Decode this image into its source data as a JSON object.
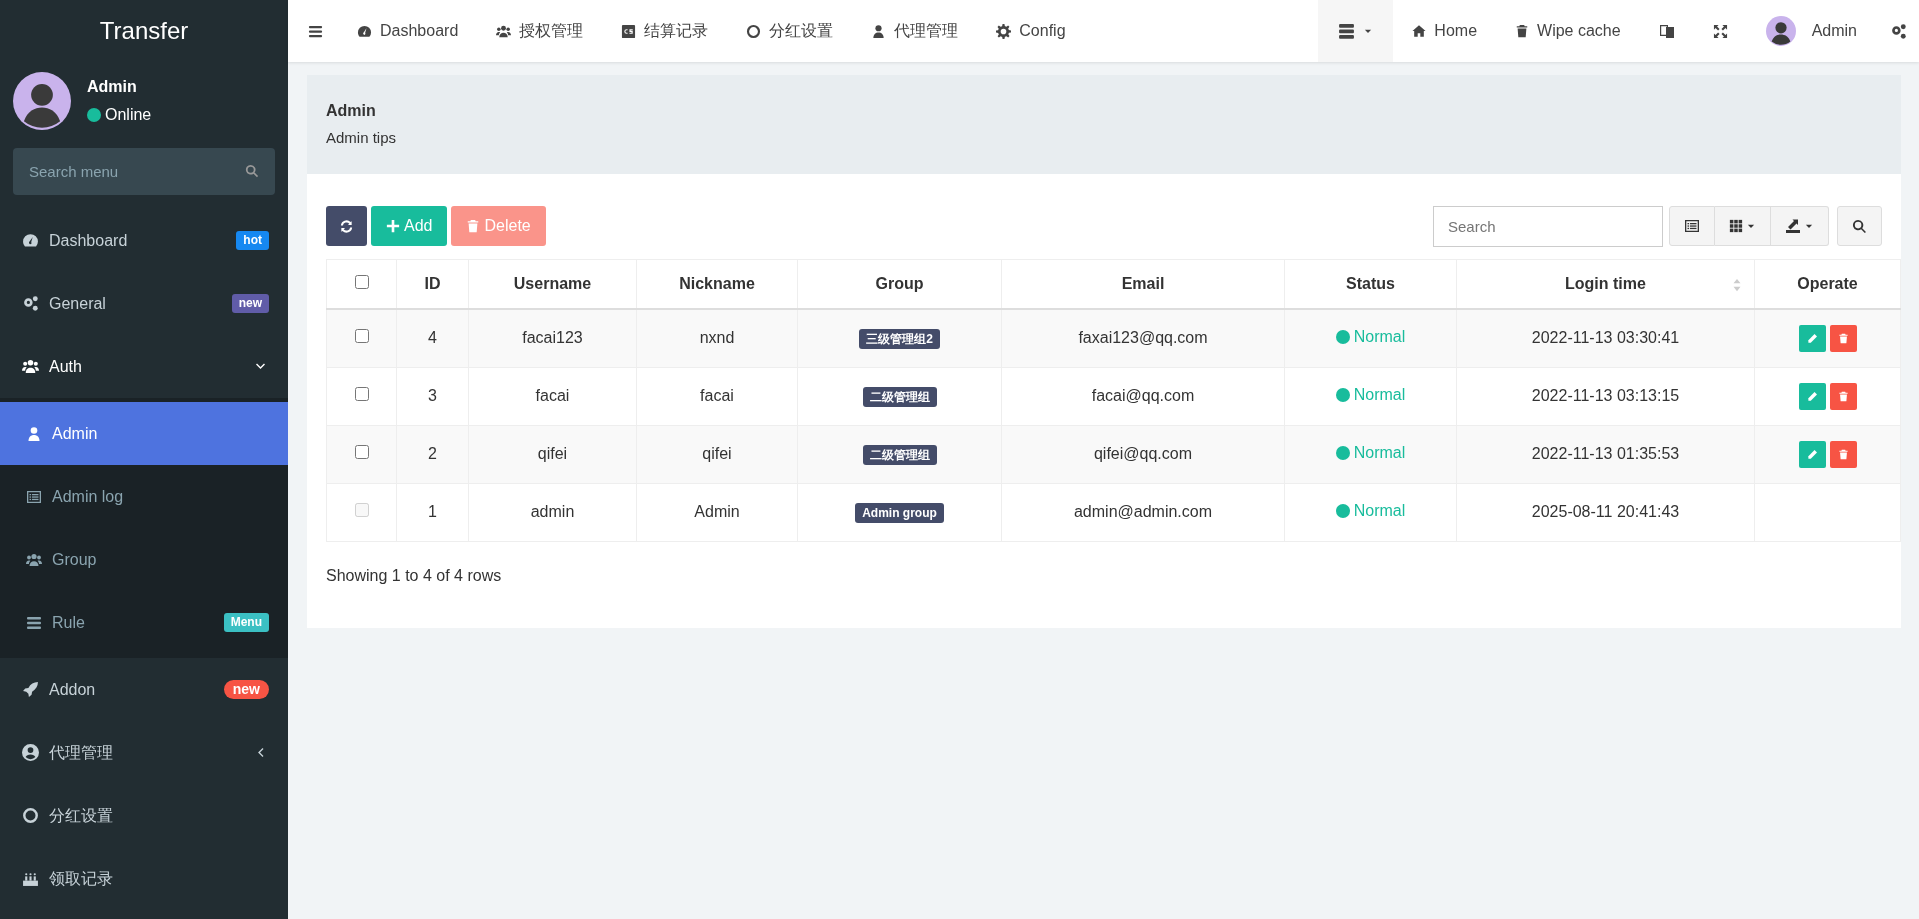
{
  "sidebar": {
    "brand": "Transfer",
    "user": {
      "name": "Admin",
      "status": "Online"
    },
    "search": {
      "placeholder": "Search menu"
    },
    "items": [
      {
        "label": "Dashboard",
        "selected": false,
        "badge": {
          "text": "hot",
          "color": "#1688f1",
          "kind": "label"
        }
      },
      {
        "label": "General",
        "selected": false,
        "badge": {
          "text": "new",
          "color": "#605ca8",
          "kind": "label"
        }
      },
      {
        "label": "Auth",
        "selected": false,
        "expanded": true,
        "children": [
          {
            "label": "Admin",
            "selected": true
          },
          {
            "label": "Admin log",
            "selected": false
          },
          {
            "label": "Group",
            "selected": false
          },
          {
            "label": "Rule",
            "selected": false,
            "badge": {
              "text": "Menu",
              "color": "#3bc0c3",
              "kind": "label"
            }
          }
        ]
      },
      {
        "label": "Addon",
        "selected": false,
        "badge": {
          "text": "new",
          "color": "#f75444",
          "kind": "pill"
        }
      },
      {
        "label": "代理管理",
        "selected": false,
        "expanded": false
      },
      {
        "label": "分红设置",
        "selected": false
      },
      {
        "label": "领取记录",
        "selected": false
      }
    ]
  },
  "topbar": {
    "nav": [
      "Dashboard",
      "授权管理",
      "结算记录",
      "分红设置",
      "代理管理",
      "Config"
    ],
    "links": [
      "Home",
      "Wipe cache"
    ],
    "user": {
      "name": "Admin"
    }
  },
  "header": {
    "title": "Admin",
    "subtitle": "Admin tips"
  },
  "toolbar": {
    "buttons": [
      {
        "kind": "refresh",
        "disabled": false
      },
      {
        "kind": "add",
        "label": "Add",
        "disabled": false
      },
      {
        "kind": "delete",
        "label": "Delete",
        "disabled": true
      }
    ],
    "search": {
      "placeholder": "Search"
    }
  },
  "table": {
    "select_all": {
      "checked": false
    },
    "columns": [
      "ID",
      "Username",
      "Nickname",
      "Group",
      "Email",
      "Status",
      "Login time",
      "Operate"
    ],
    "rows": [
      {
        "checked": false,
        "disabled": false,
        "id": "4",
        "username": "facai123",
        "nickname": "nxnd",
        "group": "三级管理组2",
        "email": "faxai123@qq.com",
        "status": "Normal",
        "login_time": "2022-11-13 03:30:41",
        "actions": true
      },
      {
        "checked": false,
        "disabled": false,
        "id": "3",
        "username": "facai",
        "nickname": "facai",
        "group": "二级管理组",
        "email": "facai@qq.com",
        "status": "Normal",
        "login_time": "2022-11-13 03:13:15",
        "actions": true
      },
      {
        "checked": false,
        "disabled": false,
        "id": "2",
        "username": "qifei",
        "nickname": "qifei",
        "group": "二级管理组",
        "email": "qifei@qq.com",
        "status": "Normal",
        "login_time": "2022-11-13 01:35:53",
        "actions": true
      },
      {
        "checked": false,
        "disabled": true,
        "id": "1",
        "username": "admin",
        "nickname": "Admin",
        "group": "Admin group",
        "email": "admin@admin.com",
        "status": "Normal",
        "login_time": "2025-08-11 20:41:43",
        "actions": false
      }
    ],
    "footer": "Showing 1 to 4 of 4 rows"
  }
}
